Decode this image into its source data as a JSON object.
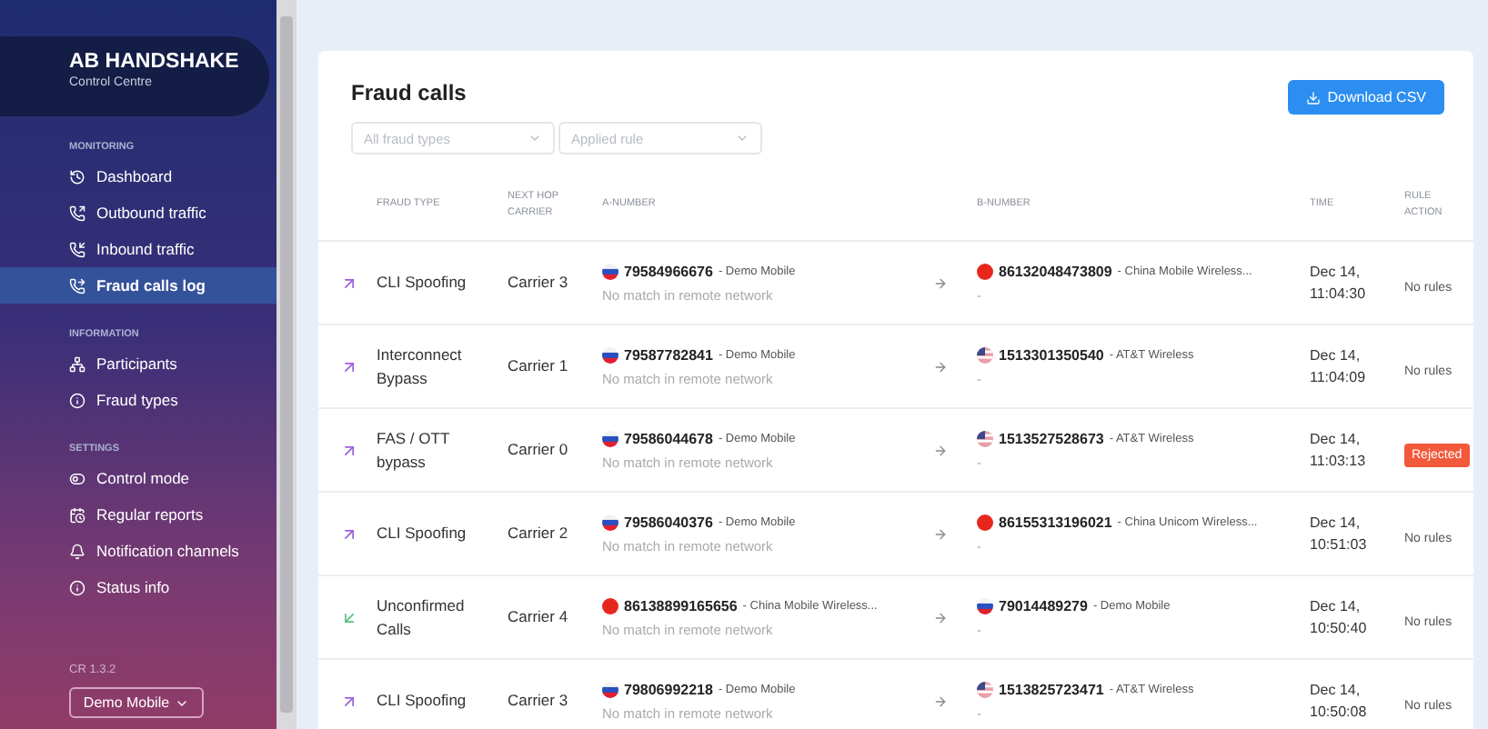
{
  "sidebar": {
    "brand": "AB HANDSHAKE",
    "subtitle": "Control Centre",
    "sections": [
      {
        "label": "MONITORING",
        "items": [
          {
            "label": "Dashboard",
            "selected": false
          },
          {
            "label": "Outbound traffic",
            "selected": false
          },
          {
            "label": "Inbound traffic",
            "selected": false
          },
          {
            "label": "Fraud calls log",
            "selected": true
          }
        ]
      },
      {
        "label": "INFORMATION",
        "items": [
          {
            "label": "Participants",
            "selected": false
          },
          {
            "label": "Fraud types",
            "selected": false
          }
        ]
      },
      {
        "label": "SETTINGS",
        "items": [
          {
            "label": "Control mode",
            "selected": false
          },
          {
            "label": "Regular reports",
            "selected": false
          },
          {
            "label": "Notification channels",
            "selected": false
          },
          {
            "label": "Status info",
            "selected": false
          }
        ]
      }
    ],
    "version": "CR 1.3.2",
    "account": "Demo Mobile"
  },
  "page": {
    "title": "Fraud calls",
    "download_button": "Download CSV",
    "filters": [
      {
        "placeholder": "All fraud types"
      },
      {
        "placeholder": "Applied rule"
      }
    ]
  },
  "table": {
    "columns": [
      "FRAUD TYPE",
      "NEXT HOP CARRIER",
      "A-NUMBER",
      "B-NUMBER",
      "TIME",
      "RULE ACTION"
    ],
    "rows": [
      {
        "kind": "outgoing",
        "fraud_type": "CLI Spoofing",
        "carrier": "Carrier 3",
        "a": {
          "kind": "ru",
          "number": "79584966676",
          "operator": "- Demo Mobile",
          "note": "No match in remote network"
        },
        "b": {
          "kind": "cn",
          "number": "86132048473809",
          "operator": "- China Mobile Wireless...",
          "note": "-"
        },
        "time": [
          "Dec 14,",
          "11:04:30"
        ],
        "rule": {
          "kind": "text",
          "text": "No rules"
        }
      },
      {
        "kind": "outgoing",
        "fraud_type": "Interconnect Bypass",
        "carrier": "Carrier 1",
        "a": {
          "kind": "ru",
          "number": "79587782841",
          "operator": "- Demo Mobile",
          "note": "No match in remote network"
        },
        "b": {
          "kind": "us",
          "number": "1513301350540",
          "operator": "- AT&T Wireless",
          "note": "-"
        },
        "time": [
          "Dec 14,",
          "11:04:09"
        ],
        "rule": {
          "kind": "text",
          "text": "No rules"
        }
      },
      {
        "kind": "outgoing",
        "fraud_type": "FAS / OTT bypass",
        "carrier": "Carrier 0",
        "a": {
          "kind": "ru",
          "number": "79586044678",
          "operator": "- Demo Mobile",
          "note": "No match in remote network"
        },
        "b": {
          "kind": "us",
          "number": "1513527528673",
          "operator": "- AT&T Wireless",
          "note": "-"
        },
        "time": [
          "Dec 14,",
          "11:03:13"
        ],
        "rule": {
          "kind": "badge",
          "text": "Rejected"
        }
      },
      {
        "kind": "outgoing",
        "fraud_type": "CLI Spoofing",
        "carrier": "Carrier 2",
        "a": {
          "kind": "ru",
          "number": "79586040376",
          "operator": "- Demo Mobile",
          "note": "No match in remote network"
        },
        "b": {
          "kind": "cn",
          "number": "86155313196021",
          "operator": "- China Unicom Wireless...",
          "note": "-"
        },
        "time": [
          "Dec 14,",
          "10:51:03"
        ],
        "rule": {
          "kind": "text",
          "text": "No rules"
        }
      },
      {
        "kind": "incoming",
        "fraud_type": "Unconfirmed Calls",
        "carrier": "Carrier 4",
        "a": {
          "kind": "cn",
          "number": "86138899165656",
          "operator": "- China Mobile Wireless...",
          "note": "No match in remote network"
        },
        "b": {
          "kind": "ru",
          "number": "79014489279",
          "operator": "- Demo Mobile",
          "note": "-"
        },
        "time": [
          "Dec 14,",
          "10:50:40"
        ],
        "rule": {
          "kind": "text",
          "text": "No rules"
        }
      },
      {
        "kind": "outgoing",
        "fraud_type": "CLI Spoofing",
        "carrier": "Carrier 3",
        "a": {
          "kind": "ru",
          "number": "79806992218",
          "operator": "- Demo Mobile",
          "note": "No match in remote network"
        },
        "b": {
          "kind": "us",
          "number": "1513825723471",
          "operator": "- AT&T Wireless",
          "note": "-"
        },
        "time": [
          "Dec 14,",
          "10:50:08"
        ],
        "rule": {
          "kind": "text",
          "text": "No rules"
        }
      }
    ]
  }
}
